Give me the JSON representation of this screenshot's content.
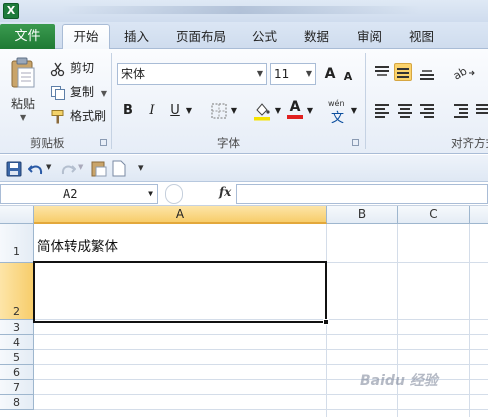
{
  "app_icon_letter": "X",
  "tabs": {
    "file": "文件",
    "home": "开始",
    "insert": "插入",
    "layout": "页面布局",
    "formula": "公式",
    "data": "数据",
    "review": "审阅",
    "view": "视图"
  },
  "clipboard": {
    "paste": "粘贴",
    "cut": "剪切",
    "copy": "复制",
    "format_painter": "格式刷",
    "group": "剪贴板"
  },
  "font": {
    "name": "宋体",
    "size": "11",
    "bold": "B",
    "italic": "I",
    "underline": "U",
    "grow": "A",
    "shrink": "A",
    "font_color_letter": "A",
    "phonetic": "wén",
    "phonetic_char": "文",
    "group": "字体",
    "font_color": "#e02020",
    "fill_color": "#f5e200"
  },
  "alignment": {
    "group": "对齐方式"
  },
  "formula_bar": {
    "name_box": "A2",
    "fx": "fx",
    "content": ""
  },
  "columns": [
    "A",
    "B",
    "C"
  ],
  "rows": [
    "1",
    "2",
    "3",
    "4",
    "5",
    "6",
    "7",
    "8"
  ],
  "cells": {
    "A1": "简体转成繁体",
    "A2": ""
  },
  "watermark": "Baidu 经验"
}
